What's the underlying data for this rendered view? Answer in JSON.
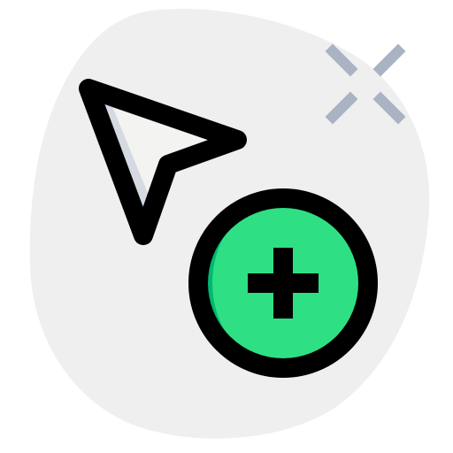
{
  "icon": {
    "name": "cursor-add-icon",
    "parts": {
      "background": "blob-background",
      "sparkle": "sparkle-icon",
      "cursor": "pointer-arrow-icon",
      "badge": "add-circle-icon",
      "plus": "plus-icon"
    }
  },
  "colors": {
    "background_blob": "#efefef",
    "sparkle": "#a9b3c3",
    "cursor_fill": "#f3f3f1",
    "cursor_shade": "#d5dae2",
    "outline": "#000000",
    "badge_fill": "#2fdf84",
    "badge_shade": "#00b871"
  }
}
